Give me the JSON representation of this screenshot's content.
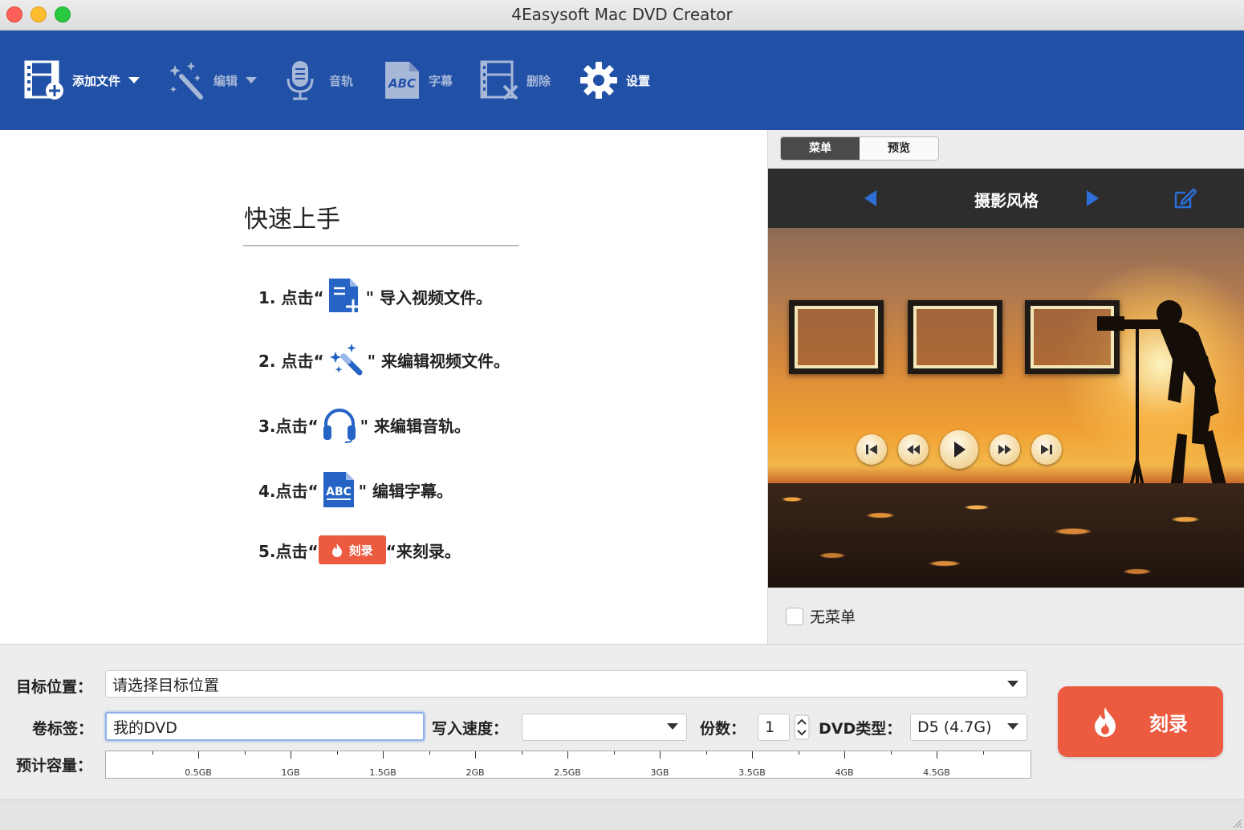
{
  "window": {
    "title": "4Easysoft Mac DVD Creator"
  },
  "toolbar": {
    "add_file": "添加文件",
    "edit": "编辑",
    "audio": "音轨",
    "subtitle": "字幕",
    "delete": "删除",
    "settings": "设置"
  },
  "quickstart": {
    "title": "快速上手",
    "steps": [
      {
        "prefix": "1. 点击“",
        "suffix": "\" 导入视频文件。",
        "icon": "add-file-icon"
      },
      {
        "prefix": "2. 点击“",
        "suffix": "\" 来编辑视频文件。",
        "icon": "magic-wand-icon"
      },
      {
        "prefix": "3.点击“",
        "suffix": "\" 来编辑音轨。",
        "icon": "headphones-icon"
      },
      {
        "prefix": "4.点击“",
        "suffix": "\" 编辑字幕。",
        "icon": "abc-subtitle-icon"
      },
      {
        "prefix": "5.点击“",
        "suffix": "“来刻录。",
        "icon": "burn-icon",
        "button_label": "刻录"
      }
    ]
  },
  "menu_panel": {
    "tabs": [
      "菜单",
      "预览"
    ],
    "active_tab": "菜单",
    "theme_name": "摄影风格",
    "no_menu_label": "无菜单",
    "no_menu_checked": false
  },
  "bottom": {
    "target_label": "目标位置：",
    "target_value": "请选择目标位置",
    "volume_label": "卷标签：",
    "volume_value": "我的DVD",
    "speed_label": "写入速度：",
    "speed_value": "",
    "copies_label": "份数：",
    "copies_value": "1",
    "dvd_type_label": "DVD类型：",
    "dvd_type_value": "D5 (4.7G)",
    "capacity_label": "预计容量：",
    "capacity_ticks": [
      "0.5GB",
      "1GB",
      "1.5GB",
      "2GB",
      "2.5GB",
      "3GB",
      "3.5GB",
      "4GB",
      "4.5GB"
    ],
    "burn_label": "刻录"
  },
  "colors": {
    "toolbar_bg": "#2150a7",
    "burn_button": "#ec5a3f",
    "accent_blue": "#2c6fd6"
  }
}
